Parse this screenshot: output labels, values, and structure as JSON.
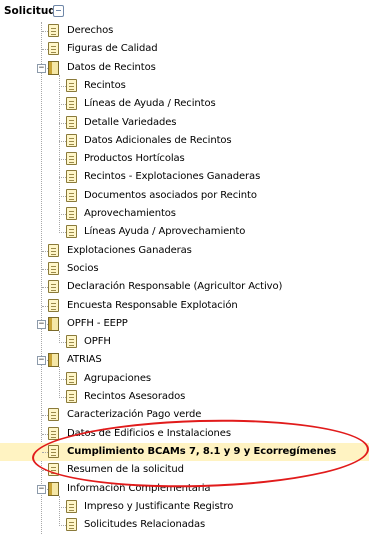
{
  "root": {
    "title": "Solicitud"
  },
  "tree": [
    {
      "label": "Derechos",
      "level": 1,
      "icon": "doc"
    },
    {
      "label": "Figuras de Calidad",
      "level": 1,
      "icon": "doc"
    },
    {
      "label": "Datos de Recintos",
      "level": 1,
      "icon": "book",
      "expanded": true
    },
    {
      "label": "Recintos",
      "level": 2,
      "icon": "doc"
    },
    {
      "label": "Líneas de Ayuda / Recintos",
      "level": 2,
      "icon": "doc"
    },
    {
      "label": "Detalle Variedades",
      "level": 2,
      "icon": "doc"
    },
    {
      "label": "Datos Adicionales de Recintos",
      "level": 2,
      "icon": "doc"
    },
    {
      "label": "Productos Hortícolas",
      "level": 2,
      "icon": "doc"
    },
    {
      "label": "Recintos - Explotaciones Ganaderas",
      "level": 2,
      "icon": "doc"
    },
    {
      "label": "Documentos asociados por Recinto",
      "level": 2,
      "icon": "doc"
    },
    {
      "label": "Aprovechamientos",
      "level": 2,
      "icon": "doc"
    },
    {
      "label": "Líneas Ayuda / Aprovechamiento",
      "level": 2,
      "icon": "doc"
    },
    {
      "label": "Explotaciones Ganaderas",
      "level": 1,
      "icon": "doc"
    },
    {
      "label": "Socios",
      "level": 1,
      "icon": "doc"
    },
    {
      "label": "Declaración Responsable (Agricultor Activo)",
      "level": 1,
      "icon": "doc"
    },
    {
      "label": "Encuesta Responsable Explotación",
      "level": 1,
      "icon": "doc"
    },
    {
      "label": "OPFH - EEPP",
      "level": 1,
      "icon": "book",
      "expanded": true
    },
    {
      "label": "OPFH",
      "level": 2,
      "icon": "doc"
    },
    {
      "label": "ATRIAS",
      "level": 1,
      "icon": "book",
      "expanded": true
    },
    {
      "label": "Agrupaciones",
      "level": 2,
      "icon": "doc"
    },
    {
      "label": "Recintos Asesorados",
      "level": 2,
      "icon": "doc"
    },
    {
      "label": "Caracterización Pago verde",
      "level": 1,
      "icon": "doc"
    },
    {
      "label": "Datos de Edificios e Instalaciones",
      "level": 1,
      "icon": "doc"
    },
    {
      "label": "Cumplimiento BCAMs 7, 8.1 y 9 y Ecorregímenes",
      "level": 1,
      "icon": "doc",
      "highlighted": true
    },
    {
      "label": "Resumen de la solicitud",
      "level": 1,
      "icon": "doc"
    },
    {
      "label": "Información Complementaria",
      "level": 1,
      "icon": "book",
      "expanded": true
    },
    {
      "label": "Impreso y Justificante Registro",
      "level": 2,
      "icon": "doc"
    },
    {
      "label": "Solicitudes Relacionadas",
      "level": 2,
      "icon": "doc"
    }
  ],
  "colors": {
    "highlight_bg": "#fff3c2",
    "annotation_ellipse": "#e11b1b"
  },
  "icons": {
    "collapse": "minus-box-icon",
    "document": "document-icon",
    "folder": "book-icon"
  }
}
